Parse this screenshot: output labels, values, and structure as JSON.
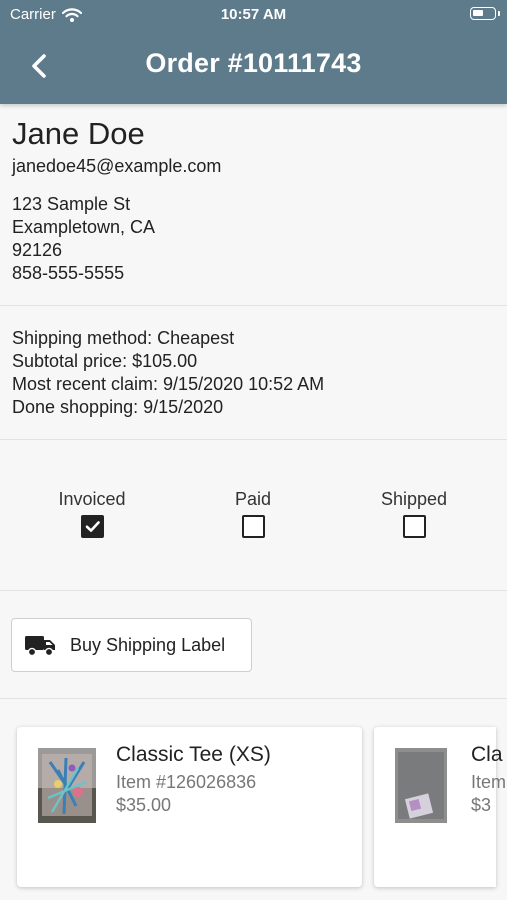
{
  "status_bar": {
    "carrier": "Carrier",
    "time": "10:57 AM",
    "wifi_icon": "wifi-icon",
    "battery_icon": "battery-icon"
  },
  "nav": {
    "title": "Order #10111743",
    "back_icon": "chevron-left-icon"
  },
  "customer": {
    "name": "Jane Doe",
    "email": "janedoe45@example.com",
    "address_line1": "123 Sample St",
    "city_state": "Exampletown, CA",
    "zip": "92126",
    "phone": "858-555-5555"
  },
  "summary": {
    "shipping_method": "Shipping method: Cheapest",
    "subtotal": "Subtotal price: $105.00",
    "recent_claim": "Most recent claim: 9/15/2020 10:52 AM",
    "done_shopping": "Done shopping: 9/15/2020"
  },
  "flags": [
    {
      "label": "Invoiced",
      "checked": true
    },
    {
      "label": "Paid",
      "checked": false
    },
    {
      "label": "Shipped",
      "checked": false
    }
  ],
  "shipping_label_button": {
    "label": "Buy Shipping Label",
    "icon": "truck-icon"
  },
  "items": [
    {
      "name": "Classic Tee (XS)",
      "item_number": "Item #126026836",
      "price": "$35.00"
    },
    {
      "name": "Cla",
      "item_number": "Item",
      "price": "$3"
    }
  ],
  "colors": {
    "header": "#5d7b8b",
    "background": "#f7f7f7"
  }
}
